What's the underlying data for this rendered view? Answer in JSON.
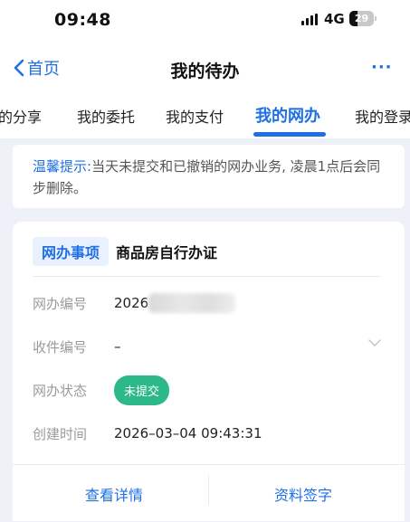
{
  "status_bar": {
    "time": "09:48",
    "network": "4G",
    "battery": "29"
  },
  "nav": {
    "back_label": "首页",
    "title": "我的待办",
    "more_label": "···"
  },
  "tabs": [
    {
      "label": "的分享"
    },
    {
      "label": "我的委托"
    },
    {
      "label": "我的支付"
    },
    {
      "label": "我的网办",
      "active": true
    },
    {
      "label": "我的登录"
    }
  ],
  "notice": {
    "label": "温馨提示:",
    "text": "当天未提交和已撤销的网办业务, 凌晨1点后会同步删除。"
  },
  "card": {
    "tag": "网办事项",
    "title": "商品房自行办证",
    "fields": [
      {
        "key": "网办编号",
        "value": "2026"
      },
      {
        "key": "收件编号",
        "value": "–"
      },
      {
        "key": "网办状态",
        "value": "未提交"
      },
      {
        "key": "创建时间",
        "value": "2026–03–04 09:43:31"
      }
    ],
    "actions": {
      "details": "查看详情",
      "sign": "资料签字"
    }
  },
  "colors": {
    "accent": "#1f6fe5",
    "status_green": "#2db88a",
    "background": "#eef2f8"
  }
}
